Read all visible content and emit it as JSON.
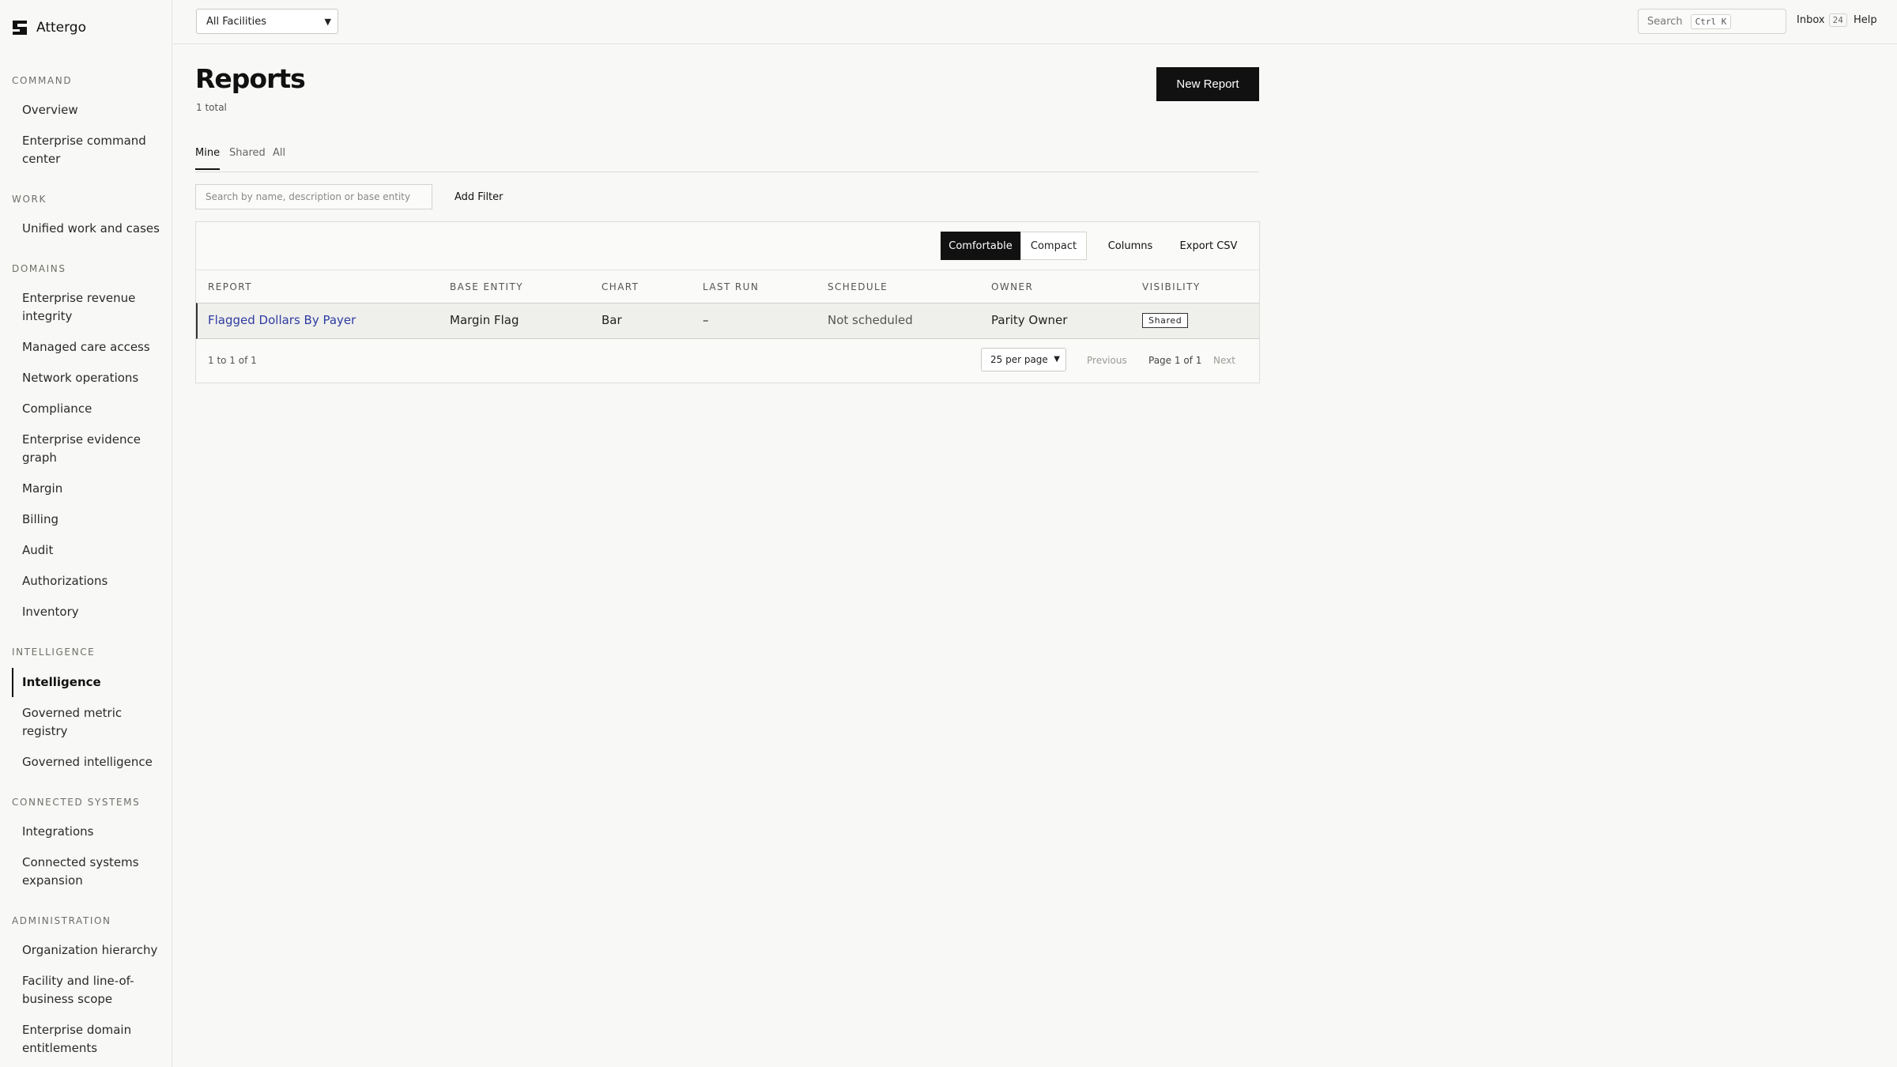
{
  "app": {
    "name": "Attergo"
  },
  "sidebar": {
    "sections": [
      {
        "label": "COMMAND",
        "items": [
          "Overview",
          "Enterprise command center"
        ]
      },
      {
        "label": "WORK",
        "items": [
          "Unified work and cases"
        ]
      },
      {
        "label": "DOMAINS",
        "items": [
          "Enterprise revenue integrity",
          "Managed care access",
          "Network operations",
          "Compliance",
          "Enterprise evidence graph",
          "Margin",
          "Billing",
          "Audit",
          "Authorizations",
          "Inventory"
        ]
      },
      {
        "label": "INTELLIGENCE",
        "items": [
          "Intelligence",
          "Governed metric registry",
          "Governed intelligence"
        ]
      },
      {
        "label": "CONNECTED SYSTEMS",
        "items": [
          "Integrations",
          "Connected systems expansion"
        ]
      },
      {
        "label": "ADMINISTRATION",
        "items": [
          "Organization hierarchy",
          "Facility and line-of-business scope",
          "Enterprise domain entitlements"
        ]
      }
    ],
    "active_item": "Intelligence"
  },
  "topbar": {
    "facility_select": "All Facilities",
    "search_label": "Search",
    "search_shortcut": "Ctrl K",
    "inbox_label": "Inbox",
    "inbox_count": "24",
    "help_label": "Help"
  },
  "page": {
    "title": "Reports",
    "subtitle": "1 total",
    "new_report_label": "New Report",
    "tabs": [
      {
        "label": "Mine",
        "active": true
      },
      {
        "label": "Shared",
        "active": false
      },
      {
        "label": "All",
        "active": false
      }
    ],
    "search_placeholder": "Search by name, description or base entity",
    "add_filter_label": "Add Filter"
  },
  "table": {
    "density_options": [
      "Comfortable",
      "Compact"
    ],
    "active_density": "Comfortable",
    "columns_label": "Columns",
    "export_label": "Export CSV",
    "headers": [
      "REPORT",
      "BASE ENTITY",
      "CHART",
      "LAST RUN",
      "SCHEDULE",
      "OWNER",
      "VISIBILITY"
    ],
    "rows": [
      {
        "report": "Flagged Dollars By Payer",
        "base_entity": "Margin Flag",
        "chart": "Bar",
        "last_run": "–",
        "schedule": "Not scheduled",
        "owner": "Parity Owner",
        "visibility": "Shared"
      }
    ],
    "footer": {
      "range": "1 to 1 of 1",
      "per_page": "25 per page",
      "previous_label": "Previous",
      "page_indicator": "Page 1 of 1",
      "next_label": "Next"
    }
  },
  "colors": {
    "accent": "#111111",
    "link": "#2d3ca0",
    "background": "#f8f8f6"
  }
}
